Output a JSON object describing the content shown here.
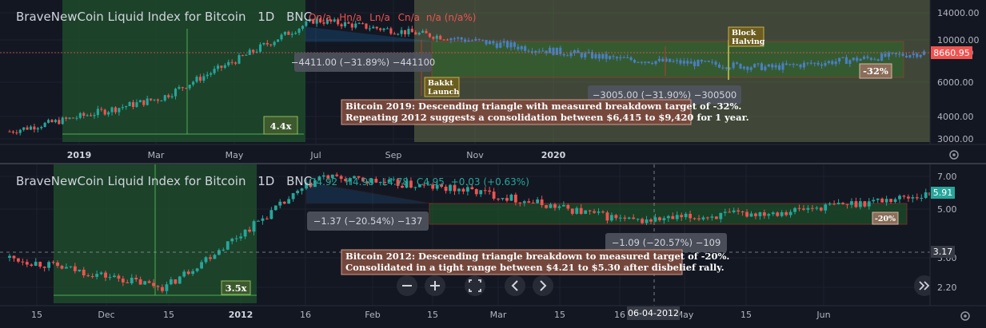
{
  "colors": {
    "background": "#131722",
    "up": "#26a69a",
    "down": "#ef5350",
    "blue_bar": "#4a7fc4",
    "green_zone": "#1f4b2c",
    "olive_zone": "#5a6b3a",
    "price_tag": "#ef5350",
    "current_tag": "#26a69a"
  },
  "top_chart": {
    "title": "BraveNewCoin Liquid Index for Bitcoin",
    "interval": "1D",
    "exchange": "BNC",
    "ohlc": {
      "o": "On/a",
      "h": "Hn/a",
      "l": "Ln/a",
      "c": "Cn/a",
      "chg": "n/a (n/a%)"
    },
    "price_axis": [
      "14000.00",
      "10000.00",
      "8000.00",
      "6000.00",
      "4000.00",
      "3000.00"
    ],
    "current_price": "8660.95",
    "time_axis": [
      "2019",
      "Mar",
      "May",
      "Jul",
      "Sep",
      "Nov",
      "2020"
    ],
    "multiplier_label": "4.4x",
    "measure_1": "−4411.00 (−31.89%) −441100",
    "measure_2": "−3005.00 (−31.90%) −300500",
    "target_label": "-32%",
    "event_1": [
      "Bakkt",
      "Launch"
    ],
    "event_2": [
      "Block",
      "Halving"
    ],
    "note_line_1": "Bitcoin 2019: Descending triangle with measured breakdown target of -32%.",
    "note_line_2": "Repeating 2012 suggests a consolidation between $6,415 to $9,420 for 1 year."
  },
  "bottom_chart": {
    "title": "BraveNewCoin Liquid Index for Bitcoin",
    "interval": "1D",
    "exchange": "BNC",
    "ohlc": {
      "o": "O4.92",
      "h": "H4.98",
      "l": "L4.78",
      "c": "C4.95",
      "chg": "+0.03 (+0.63%)"
    },
    "price_axis": [
      "7.00",
      "5.00",
      "3.00",
      "2.20"
    ],
    "current_price": "5.91",
    "crosshair_price": "3.17",
    "crosshair_date": "06-04-2012",
    "time_axis": [
      "15",
      "Dec",
      "15",
      "2012",
      "16",
      "Feb",
      "15",
      "Mar",
      "15",
      "16",
      "May",
      "15",
      "Jun"
    ],
    "multiplier_label": "3.5x",
    "measure_1": "−1.37 (−20.54%) −137",
    "measure_2": "−1.09 (−20.57%) −109",
    "target_label": "-20%",
    "note_line_1": "Bitcoin 2012: Descending triangle breakdown to measured target of -20%.",
    "note_line_2": "Consolidated in a tight range between $4.21 to $5.30 after disbelief rally."
  },
  "nav_icons": [
    "minus-icon",
    "plus-icon",
    "reset-icon",
    "chevron-left-icon",
    "chevron-right-icon",
    "scroll-to-end-icon",
    "settings-icon"
  ],
  "chart_data": [
    {
      "type": "bar",
      "title": "BraveNewCoin Liquid Index for Bitcoin 1D BNC (2019)",
      "x_range": [
        "2019",
        "2020"
      ],
      "ylim": [
        3000,
        14000
      ],
      "y_ticks": [
        3000,
        4000,
        6000,
        8000,
        10000,
        14000
      ],
      "log_scale": true,
      "key_points": [
        {
          "x": "Dec 2018",
          "y": 3300
        },
        {
          "x": "Apr 2019",
          "y": 5000
        },
        {
          "x": "Jun 2019",
          "y": 12800
        },
        {
          "x": "Sep 2019",
          "y": 10000
        },
        {
          "x": "Oct 2019",
          "y": 8000
        },
        {
          "x": "Dec 2019",
          "y": 7200
        },
        {
          "x": "Jan 2020",
          "y": 8660.95
        }
      ],
      "consolidation_range": [
        6415,
        9420
      ],
      "target_pct": -32
    },
    {
      "type": "bar",
      "title": "BraveNewCoin Liquid Index for Bitcoin 1D BNC (2011-2012)",
      "x_range": [
        "Nov 2011",
        "Jun 2012"
      ],
      "ylim": [
        2.0,
        7.5
      ],
      "y_ticks": [
        2.2,
        3.0,
        5.0,
        7.0
      ],
      "log_scale": true,
      "key_points": [
        {
          "x": "Nov 2011",
          "y": 3.0
        },
        {
          "x": "Nov 18 2011",
          "y": 2.2
        },
        {
          "x": "Jan 2012",
          "y": 7.0
        },
        {
          "x": "Feb 2012",
          "y": 6.0
        },
        {
          "x": "Feb 15 2012",
          "y": 4.4
        },
        {
          "x": "Apr 2012",
          "y": 4.9
        },
        {
          "x": "Jun 2012",
          "y": 5.91
        }
      ],
      "consolidation_range": [
        4.21,
        5.3
      ],
      "target_pct": -20
    }
  ]
}
